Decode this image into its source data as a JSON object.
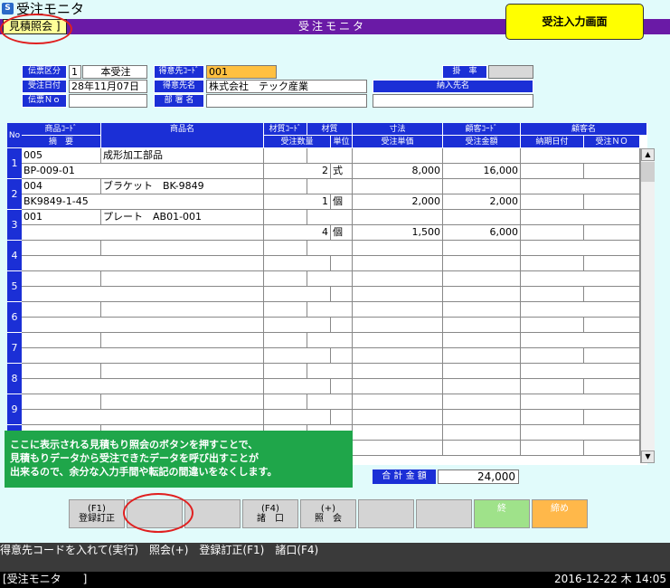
{
  "window": {
    "title": "受注モニタ",
    "icon": "app-icon"
  },
  "header": {
    "mode_label": "見積照会 ]",
    "monitor_title": "受注モニタ",
    "entry_button": "受注入力画面"
  },
  "form": {
    "slip_type_label": "伝票区分",
    "slip_type_code": "1",
    "slip_type_name": "本受注",
    "customer_code_label": "得意先ｺｰﾄﾞ",
    "customer_code": "001",
    "rate_label": "掛　率",
    "rate_value": "",
    "order_date_label": "受注日付",
    "order_date": "28年11月07日",
    "customer_name_label": "得意先名",
    "customer_name": "株式会社　テック産業",
    "delivery_label": "納入先名",
    "delivery_value": "",
    "slip_no_label": "伝票Ｎｏ",
    "slip_no": "",
    "department_label": "部 署 名",
    "department_value": ""
  },
  "table": {
    "headers": {
      "no": "No",
      "product_code": "商品ｺｰﾄﾞ",
      "summary": "摘　要",
      "product_name": "商品名",
      "material_code": "材質ｺｰﾄﾞ",
      "material": "材質",
      "qty": "受注数量",
      "unit": "単位",
      "dimension": "寸法",
      "unit_price": "受注単価",
      "customer_code": "顧客ｺｰﾄﾞ",
      "amount": "受注金額",
      "customer_name": "顧客名",
      "due_date": "納期日付",
      "order_no": "受注ＮＯ"
    },
    "rows": [
      {
        "no": "1",
        "product_code": "005",
        "product_name": "成形加工部品",
        "summary": "BP-009-01",
        "qty": "2",
        "unit": "式",
        "unit_price": "8,000",
        "amount": "16,000"
      },
      {
        "no": "2",
        "product_code": "004",
        "product_name": "ブラケット　BK-9849",
        "summary": "BK9849-1-45",
        "qty": "1",
        "unit": "個",
        "unit_price": "2,000",
        "amount": "2,000"
      },
      {
        "no": "3",
        "product_code": "001",
        "product_name": "プレート　AB01-001",
        "summary": "",
        "qty": "4",
        "unit": "個",
        "unit_price": "1,500",
        "amount": "6,000"
      },
      {
        "no": "4"
      },
      {
        "no": "5"
      },
      {
        "no": "6"
      },
      {
        "no": "7"
      },
      {
        "no": "8"
      },
      {
        "no": "9"
      },
      {
        "no": "10"
      }
    ]
  },
  "note": {
    "line1": "ここに表示される見積もり照会のボタンを押すことで、",
    "line2": "見積もりデータから受注できたデータを呼び出すことが",
    "line3": "出来るので、余分な入力手間や転記の間違いをなくします。"
  },
  "total": {
    "label": "合 計 金 額",
    "value": "24,000"
  },
  "fkeys": [
    {
      "label": "(F1)\n登録訂正"
    },
    {
      "label": ""
    },
    {
      "label": ""
    },
    {
      "label": "(F4)\n諸　口"
    },
    {
      "label": "(+)\n照　会"
    },
    {
      "label": ""
    },
    {
      "label": ""
    },
    {
      "label": "終"
    },
    {
      "label": "締め"
    }
  ],
  "status": {
    "hint": "得意先コードを入れて(実行)　照会(+)　登録訂正(F1)　諸口(F4)"
  },
  "taskbar": {
    "app": "[受注モニタ　　]",
    "clock": "2016-12-22 木 14:05"
  },
  "colors": {
    "header_purple": "#6a1aa6",
    "label_blue": "#1b2fd6",
    "note_green": "#1fa64a",
    "accent_yellow": "#ffff00",
    "highlight_orange": "#ffc040",
    "fkey_green": "#9fe28a",
    "fkey_orange": "#ffb84a"
  }
}
